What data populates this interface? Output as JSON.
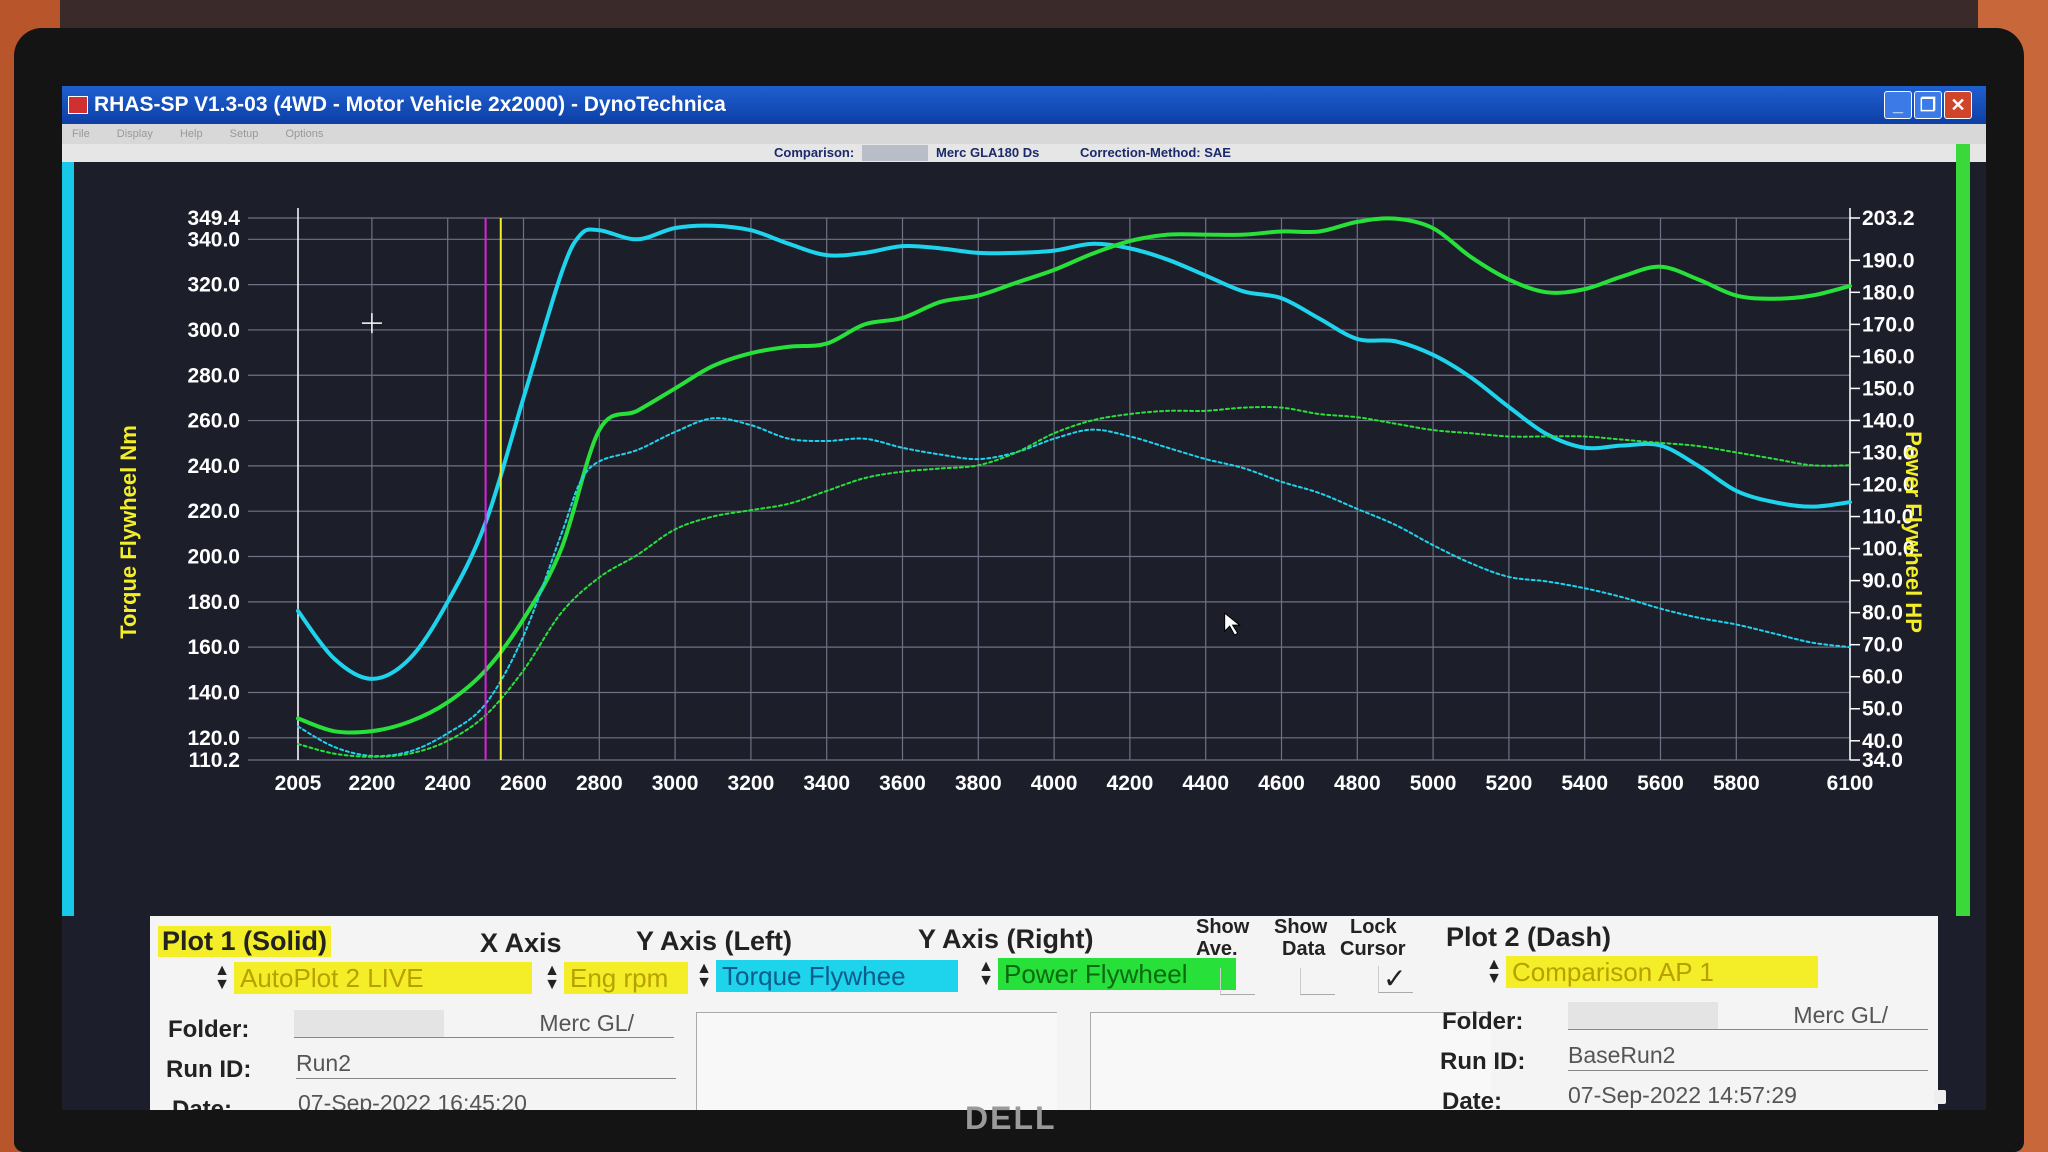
{
  "window": {
    "title": "RHAS-SP V1.3-03  (4WD - Motor Vehicle 2x2000) - DynoTechnica",
    "minimize": "_",
    "maximize": "❐",
    "close": "✕"
  },
  "menubar": [
    "File",
    "Display",
    "Help",
    "Setup",
    "Options"
  ],
  "infobar": {
    "comparison_label": "Comparison:",
    "comparison_file": "Merc GLA180 Ds",
    "correction_method": "Correction-Method: SAE"
  },
  "colors": {
    "torque": "#1ed3ec",
    "power": "#27e03a",
    "axis_label": "#f3ee27",
    "cursor_magenta": "#e020e0",
    "cursor_yellow": "#f3ee27",
    "grid": "#6e7284"
  },
  "chart_data": {
    "type": "line",
    "xlabel": "",
    "y_left_label": "Torque Flywheel Nm",
    "y_right_label": "Power Flywheel HP",
    "xlim": [
      2005,
      6100
    ],
    "y_left_lim": [
      110.2,
      349.4
    ],
    "y_right_lim": [
      34.0,
      203.2
    ],
    "x_ticks": [
      "2005",
      "2200",
      "2400",
      "2600",
      "2800",
      "3000",
      "3200",
      "3400",
      "3600",
      "3800",
      "4000",
      "4200",
      "4400",
      "4600",
      "4800",
      "5000",
      "5200",
      "5400",
      "5600",
      "5800",
      "6100"
    ],
    "y_left_ticks": [
      "110.2",
      "120.0",
      "140.0",
      "160.0",
      "180.0",
      "200.0",
      "220.0",
      "240.0",
      "260.0",
      "280.0",
      "300.0",
      "320.0",
      "340.0",
      "349.4"
    ],
    "y_right_ticks": [
      "34.0",
      "40.0",
      "50.0",
      "60.0",
      "70.0",
      "80.0",
      "90.0",
      "100.0",
      "110.0",
      "120.0",
      "130.0",
      "140.0",
      "150.0",
      "160.0",
      "170.0",
      "180.0",
      "190.0",
      "203.2"
    ],
    "cursor_lines_rpm": [
      2500,
      2540
    ],
    "grid": true,
    "series": [
      {
        "name": "Torque Flywheel",
        "axis": "left",
        "style": "solid",
        "x": [
          2005,
          2100,
          2200,
          2300,
          2400,
          2500,
          2600,
          2700,
          2750,
          2800,
          2900,
          3000,
          3100,
          3200,
          3300,
          3400,
          3500,
          3600,
          3700,
          3800,
          3900,
          4000,
          4100,
          4200,
          4300,
          4400,
          4500,
          4600,
          4700,
          4800,
          4900,
          5000,
          5100,
          5200,
          5300,
          5400,
          5500,
          5600,
          5700,
          5800,
          5900,
          6000,
          6100
        ],
        "y": [
          176,
          155,
          146,
          155,
          180,
          215,
          270,
          325,
          342,
          344,
          340,
          345,
          346,
          344,
          338,
          333,
          334,
          337,
          336,
          334,
          334,
          335,
          338,
          336,
          331,
          324,
          317,
          314,
          305,
          296,
          295,
          289,
          279,
          266,
          254,
          248,
          249,
          249,
          240,
          229,
          224,
          222,
          224
        ]
      },
      {
        "name": "Power Flywheel",
        "axis": "right",
        "style": "solid",
        "x": [
          2005,
          2100,
          2200,
          2300,
          2400,
          2500,
          2600,
          2700,
          2800,
          2900,
          3000,
          3100,
          3200,
          3300,
          3400,
          3500,
          3600,
          3700,
          3800,
          3900,
          4000,
          4100,
          4200,
          4300,
          4400,
          4500,
          4600,
          4700,
          4800,
          4900,
          5000,
          5100,
          5200,
          5300,
          5400,
          5500,
          5600,
          5700,
          5800,
          5900,
          6000,
          6100
        ],
        "y": [
          47,
          43,
          43,
          46,
          52,
          62,
          78,
          100,
          137,
          143,
          150,
          157,
          161,
          163,
          164,
          170,
          172,
          177,
          179,
          183,
          187,
          192,
          196,
          198,
          198,
          198,
          199,
          199,
          202,
          203,
          200,
          191,
          184,
          180,
          181,
          185,
          188,
          184,
          179,
          178,
          179,
          182
        ]
      },
      {
        "name": "Torque Flywheel (Comparison)",
        "axis": "left",
        "style": "dash",
        "x": [
          2005,
          2100,
          2200,
          2300,
          2400,
          2500,
          2600,
          2700,
          2750,
          2800,
          2900,
          3000,
          3100,
          3200,
          3300,
          3400,
          3500,
          3600,
          3700,
          3800,
          3900,
          4000,
          4100,
          4200,
          4300,
          4400,
          4500,
          4600,
          4700,
          4800,
          4900,
          5000,
          5100,
          5200,
          5300,
          5400,
          5500,
          5600,
          5700,
          5800,
          5900,
          6000,
          6100
        ],
        "y": [
          125,
          116,
          112,
          114,
          122,
          135,
          165,
          210,
          233,
          242,
          247,
          255,
          261,
          258,
          252,
          251,
          252,
          248,
          245,
          243,
          246,
          252,
          256,
          253,
          248,
          243,
          239,
          233,
          228,
          221,
          214,
          205,
          197,
          191,
          189,
          186,
          182,
          177,
          173,
          170,
          166,
          162,
          160
        ]
      },
      {
        "name": "Power Flywheel (Comparison)",
        "axis": "right",
        "style": "dash",
        "x": [
          2005,
          2100,
          2200,
          2300,
          2400,
          2500,
          2600,
          2700,
          2800,
          2900,
          3000,
          3100,
          3200,
          3300,
          3400,
          3500,
          3600,
          3700,
          3800,
          3900,
          4000,
          4100,
          4200,
          4300,
          4400,
          4500,
          4600,
          4700,
          4800,
          4900,
          5000,
          5100,
          5200,
          5300,
          5400,
          5500,
          5600,
          5700,
          5800,
          5900,
          6000,
          6100
        ],
        "y": [
          39,
          36,
          35,
          36,
          40,
          48,
          62,
          80,
          91,
          98,
          106,
          110,
          112,
          114,
          118,
          122,
          124,
          125,
          126,
          130,
          136,
          140,
          142,
          143,
          143,
          144,
          144,
          142,
          141,
          139,
          137,
          136,
          135,
          135,
          135,
          134,
          133,
          132,
          130,
          128,
          126,
          126
        ]
      }
    ]
  },
  "plot1": {
    "header": "Plot 1 (Solid)",
    "selection": "AutoPlot 2 LIVE",
    "folder_label": "Folder:",
    "folder_value": "Merc GL/",
    "run_id_label": "Run ID:",
    "run_id_value": "Run2",
    "date_label": "Date:",
    "date_value": "07-Sep-2022  16:45:20"
  },
  "x_axis": {
    "header": "X Axis",
    "selection": "Eng rpm"
  },
  "y_axis_left": {
    "header": "Y Axis (Left)",
    "selection": "Torque Flywhee"
  },
  "y_axis_right": {
    "header": "Y Axis (Right)",
    "selection": "Power Flywheel"
  },
  "toggles": {
    "show_ave_line1": "Show",
    "show_ave_line2": "Ave.",
    "show_data_line1": "Show",
    "show_data_line2": "Data",
    "lock_cursor_line1": "Lock",
    "lock_cursor_line2": "Cursor",
    "show_ave": false,
    "show_data": false,
    "lock_cursor": true,
    "checkmark": "✓"
  },
  "plot2": {
    "header": "Plot 2 (Dash)",
    "selection": "Comparison AP 1",
    "folder_label": "Folder:",
    "folder_value": "Merc GL/",
    "run_id_label": "Run ID:",
    "run_id_value": "BaseRun2",
    "date_label": "Date:",
    "date_value": "07-Sep-2022  14:57:29"
  },
  "monitor_brand": "DELL"
}
